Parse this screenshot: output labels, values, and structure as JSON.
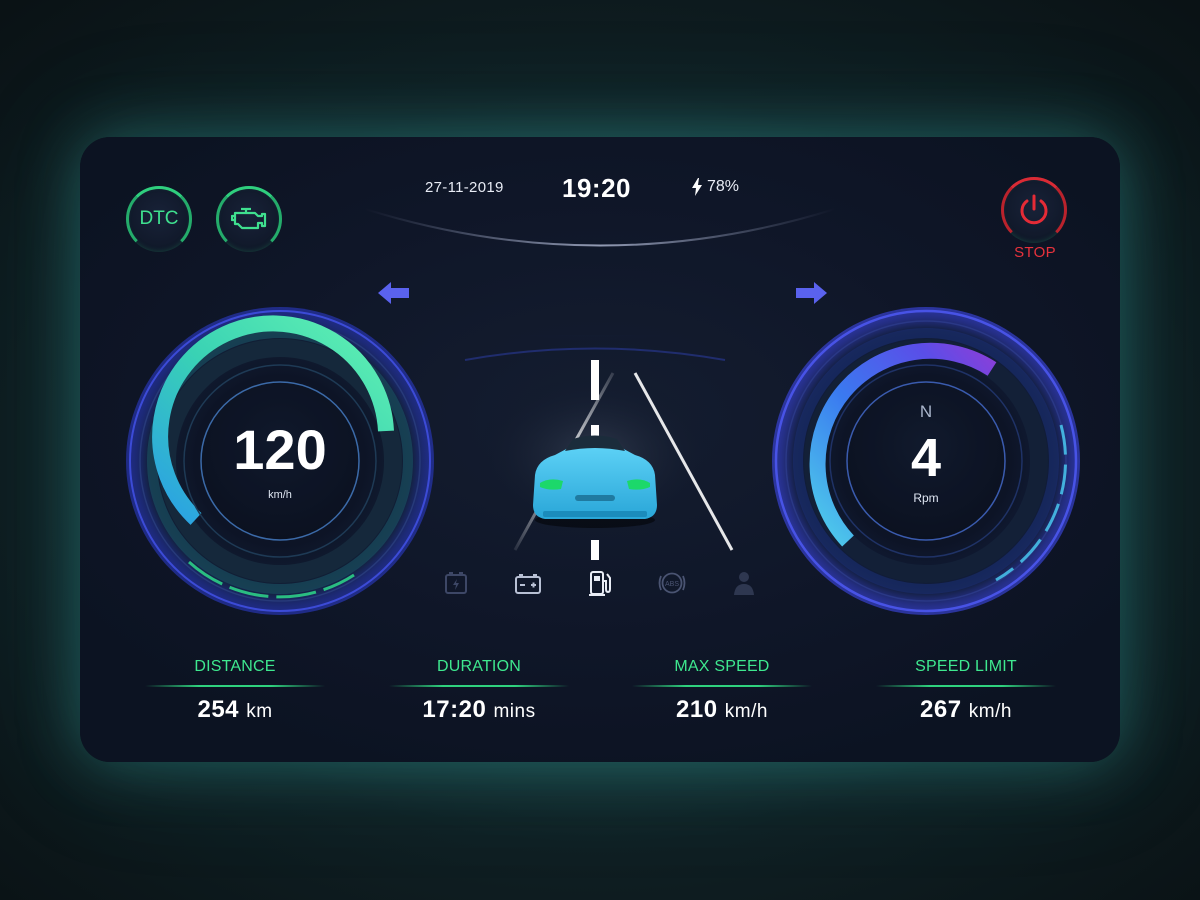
{
  "status_bar": {
    "date": "27-11-2019",
    "time": "19:20",
    "battery": "78%"
  },
  "warnings": {
    "dtc_label": "DTC",
    "engine_icon": "check-engine-icon"
  },
  "power": {
    "stop_label": "STOP",
    "icon": "power-icon",
    "color": "#e52b36"
  },
  "indicators": {
    "left": "turn-left-arrow-icon",
    "right": "turn-right-arrow-icon",
    "color": "#5a62ee"
  },
  "speedometer": {
    "value": "120",
    "unit": "km/h",
    "accent": "#3fe0a8"
  },
  "tachometer": {
    "gear": "N",
    "value": "4",
    "unit": "Rpm",
    "accent": "#5a62ee"
  },
  "status_icons": [
    "battery-charging-icon",
    "car-battery-icon",
    "fuel-pump-icon",
    "abs-icon",
    "seatbelt-icon"
  ],
  "stats": [
    {
      "label": "DISTANCE",
      "value": "254",
      "unit": "km"
    },
    {
      "label": "DURATION",
      "value": "17:20",
      "unit": "mins"
    },
    {
      "label": "MAX SPEED",
      "value": "210",
      "unit": "km/h"
    },
    {
      "label": "SPEED LIMIT",
      "value": "267",
      "unit": "km/h"
    }
  ],
  "colors": {
    "green": "#3ee88f",
    "background": "#0f1628"
  }
}
